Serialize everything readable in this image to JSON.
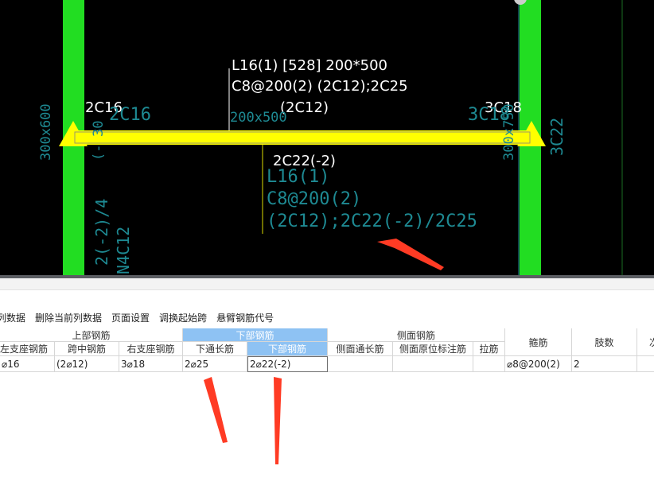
{
  "cad": {
    "beam_annotation_line1": "L16(1) [528] 200*500",
    "beam_annotation_line2": "C8@200(2) (2C12);2C25",
    "beam_annotation_line3": "(2C12)",
    "left_top_bar": "2C16",
    "right_top_bar": "3C18",
    "bottom_bar": "2C22(-2)",
    "section_dim": "200x500",
    "cyan_line1": "L16(1)",
    "cyan_line2": "C8@200(2)",
    "cyan_line3": "(2C12);2C22(-2)/2C25",
    "cyan_left_col": "300x600",
    "cyan_left_top": "2C16",
    "cyan_left_paren": "(-",
    "cyan_left_30": "30",
    "cyan_left_bottom1": "2(-2)/4",
    "cyan_left_bottom2": "N4C12",
    "cyan_right_top": "3C18",
    "cyan_right_col": "300x750",
    "cyan_right_bar": "3C22",
    "colors": {
      "column": "#22dd22",
      "beam": "#ffff00",
      "cyan": "#1e8a93",
      "accent": "#ff3b24"
    }
  },
  "toolbar": {
    "items": [
      "列数据",
      "删除当前列数据",
      "页面设置",
      "调换起始跨",
      "悬臂钢筋代号"
    ]
  },
  "grid": {
    "groups": {
      "top": "上部钢筋",
      "bottom": "下部钢筋",
      "side": "侧面钢筋",
      "stirrup": "箍筋",
      "legs": "肢数",
      "next": "次"
    },
    "columns": {
      "left_support": "左支座钢筋",
      "mid_span": "跨中钢筋",
      "right_support": "右支座钢筋",
      "bottom_through": "下通长筋",
      "bottom_rebar": "下部钢筋",
      "side_through": "侧面通长筋",
      "side_in_situ": "侧面原位标注筋",
      "tie": "拉筋"
    },
    "row": {
      "left_support": "⌀16",
      "mid_span": "(2⌀12)",
      "right_support": "3⌀18",
      "bottom_through": "2⌀25",
      "bottom_rebar": "2⌀22(-2)",
      "side_through": "",
      "side_in_situ": "",
      "tie": "",
      "stirrup": "⌀8@200(2)",
      "legs": "2"
    }
  }
}
